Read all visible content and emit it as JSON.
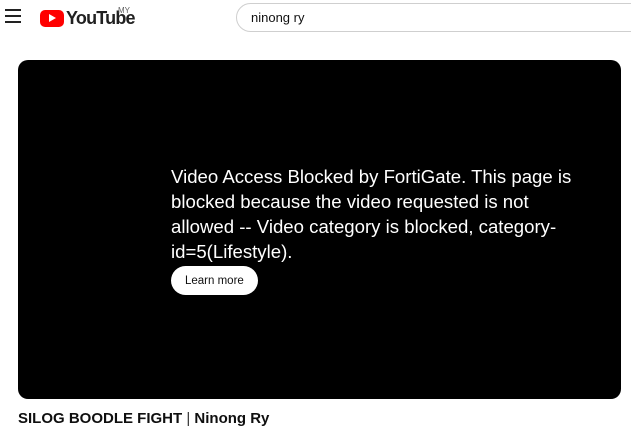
{
  "header": {
    "logo_text": "YouTube",
    "country_code": "MY",
    "search_value": "ninong ry"
  },
  "player": {
    "blocked_message": "Video Access Blocked by FortiGate. This page is blocked because the video requested is not allowed -- Video category is blocked, category-id=5(Lifestyle).",
    "learn_more_label": "Learn more"
  },
  "video": {
    "title_part1": "SILOG BOODLE FIGHT",
    "separator": " | ",
    "title_part2": "Ninong Ry"
  },
  "colors": {
    "brand_red": "#ff0000",
    "player_bg": "#000000"
  },
  "icons": [
    "menu-icon",
    "youtube-logo-icon"
  ]
}
